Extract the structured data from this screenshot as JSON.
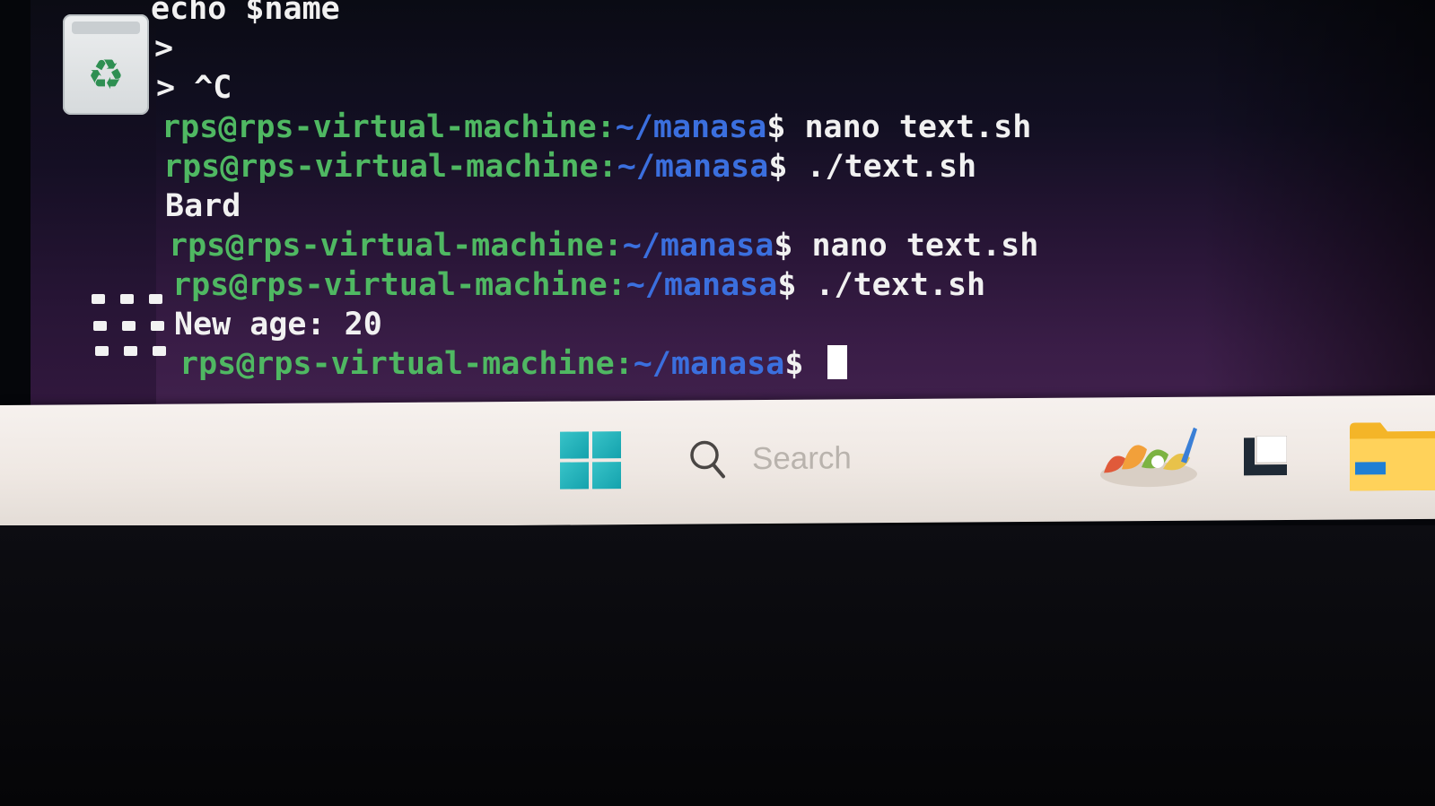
{
  "desktop": {
    "icons": [
      {
        "name": "trash",
        "icon": "recycle-icon",
        "glyph": "♻"
      },
      {
        "name": "show-apps",
        "icon": "grid-icon"
      }
    ]
  },
  "terminal": {
    "lines": [
      {
        "type": "output",
        "text": "echo $name"
      },
      {
        "type": "output",
        "text": ">"
      },
      {
        "type": "output",
        "text": "> ^C"
      },
      {
        "type": "prompt",
        "user": "rps@rps-virtual-machine:",
        "path": "~/manasa",
        "dollar": "$",
        "command": " nano text.sh"
      },
      {
        "type": "prompt",
        "user": "rps@rps-virtual-machine:",
        "path": "~/manasa",
        "dollar": "$",
        "command": " ./text.sh"
      },
      {
        "type": "output",
        "text": "Bard"
      },
      {
        "type": "prompt",
        "user": "rps@rps-virtual-machine:",
        "path": "~/manasa",
        "dollar": "$",
        "command": " nano text.sh"
      },
      {
        "type": "prompt",
        "user": "rps@rps-virtual-machine:",
        "path": "~/manasa",
        "dollar": "$",
        "command": " ./text.sh"
      },
      {
        "type": "output",
        "text": "New age: 20"
      },
      {
        "type": "prompt",
        "user": "rps@rps-virtual-machine:",
        "path": "~/manasa",
        "dollar": "$",
        "command": " ",
        "cursor": true
      }
    ],
    "colors": {
      "user": "#4fb862",
      "path": "#3b6fde",
      "text": "#f1f1f1"
    }
  },
  "taskbar": {
    "start_icon": "windows-start-icon",
    "search": {
      "icon": "search-icon",
      "placeholder": "Search"
    },
    "items": [
      {
        "name": "widgets",
        "icon": "widgets-icon"
      },
      {
        "name": "task-view",
        "icon": "task-view-icon"
      },
      {
        "name": "file-explorer",
        "icon": "folder-icon"
      }
    ],
    "accent": "#14a2ad"
  }
}
